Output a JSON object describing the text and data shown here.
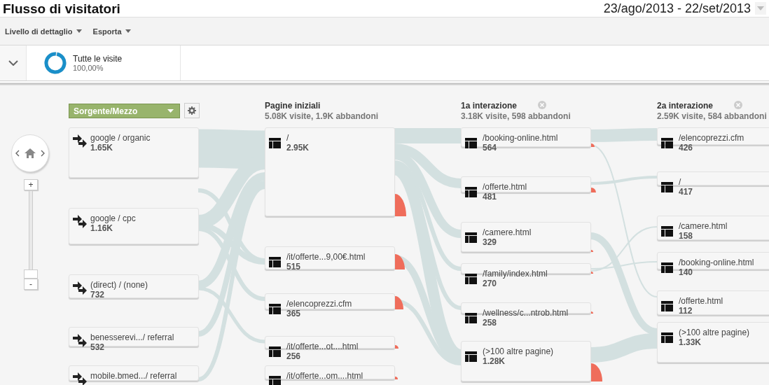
{
  "page_title": "Flusso di visitatori",
  "date_range": "23/ago/2013 - 22/set/2013",
  "toolbar": [
    {
      "label": "Livello di dettaglio"
    },
    {
      "label": "Esporta"
    }
  ],
  "segment": {
    "name": "Tutte le visite",
    "share": "100,00%",
    "level": 1
  },
  "zoom": {
    "plus": "+",
    "minus": "-",
    "level": 0
  },
  "columns": [
    {
      "kind": "dimension",
      "dropdown": "Sorgente/Mezzo",
      "nodes": [
        {
          "label": "google / organic",
          "value": "1.65K"
        },
        {
          "label": "google / cpc",
          "value": "1.16K"
        },
        {
          "label": "(direct) / (none)",
          "value": "732"
        },
        {
          "label": "benesserevi.../ referral",
          "value": "532"
        },
        {
          "label": "mobile.bmed.../ referral"
        }
      ]
    },
    {
      "kind": "pages",
      "title": "Pagine iniziali",
      "summary": "5.08K visite, 1.9K abbandoni",
      "nodes": [
        {
          "label": "/",
          "value": "2.95K"
        },
        {
          "label": "/it/offerte...9,00€.html",
          "value": "515"
        },
        {
          "label": "/elencoprezzi.cfm",
          "value": "365"
        },
        {
          "label": "/it/offerte...ot....html",
          "value": "256"
        },
        {
          "label": "/it/offerte...om....html"
        }
      ]
    },
    {
      "kind": "interaction",
      "title": "1a interazione",
      "summary": "3.18K visite, 598 abbandoni",
      "nodes": [
        {
          "label": "/booking-online.html",
          "value": "564"
        },
        {
          "label": "/offerte.html",
          "value": "481"
        },
        {
          "label": "/camere.html",
          "value": "329"
        },
        {
          "label": "/family/index.html",
          "value": "270"
        },
        {
          "label": "/wellness/c...ntrob.html",
          "value": "258"
        },
        {
          "label": "(>100 altre pagine)",
          "value": "1.28K"
        }
      ]
    },
    {
      "kind": "interaction",
      "title": "2a interazione",
      "summary": "2.59K visite, 584 abbandoni",
      "nodes": [
        {
          "label": "/elencoprezzi.cfm",
          "value": "426"
        },
        {
          "label": "/",
          "value": "417"
        },
        {
          "label": "/camere.html",
          "value": "158"
        },
        {
          "label": "/booking-online.html",
          "value": "140"
        },
        {
          "label": "/offerte.html",
          "value": "112"
        },
        {
          "label": "(>100 altre pagine)",
          "value": "1.33K"
        }
      ]
    }
  ]
}
